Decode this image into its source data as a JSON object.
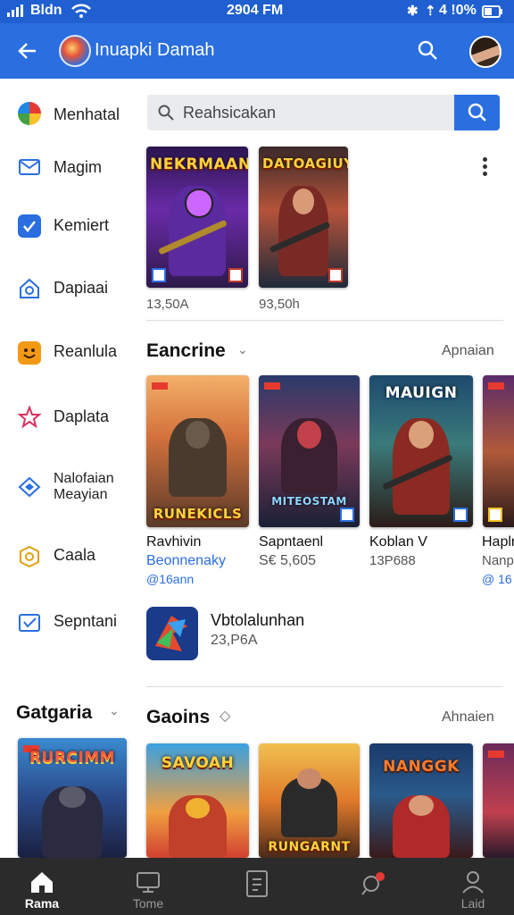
{
  "status_bar": {
    "carrier": "Bldn",
    "time": "2904 FM",
    "battery": "4 !0%"
  },
  "app_bar": {
    "title": "Inuapki Damah",
    "icons": [
      "back-arrow-icon",
      "app-logo",
      "search-icon",
      "avatar"
    ]
  },
  "sidebar": {
    "items": [
      {
        "label": "Menhatal",
        "icon": "color-wheel-icon"
      },
      {
        "label": "Magim",
        "icon": "mail-icon"
      },
      {
        "label": "Kemiert",
        "icon": "check-square-icon"
      },
      {
        "label": "Dapiaai",
        "icon": "home-shield-icon"
      },
      {
        "label": "Reanlula",
        "icon": "smiley-icon"
      },
      {
        "label": "Daplata",
        "icon": "star-icon"
      },
      {
        "label": "Nalofaian",
        "label2": "Meayian",
        "icon": "badge-icon"
      },
      {
        "label": "Caala",
        "icon": "coin-icon"
      },
      {
        "label": "Sepntani",
        "icon": "mail-check-icon"
      }
    ]
  },
  "search": {
    "placeholder": "Reahsicakan"
  },
  "top_row": [
    {
      "poster_title": "NEKRMAAN",
      "count": "13,50A"
    },
    {
      "poster_title": "DATOAGIUY",
      "count": "93,50h"
    }
  ],
  "featured": {
    "title": "Eancrine",
    "link": "Apnaian",
    "cards": [
      {
        "poster_title": "",
        "poster_bottom": "RUNEKICLS",
        "name": "Ravhivin",
        "sub": "Beonnenaky",
        "meta": "@16ann"
      },
      {
        "poster_title": "",
        "poster_bottom": "MITEOSTAM",
        "name": "Sapntaenl",
        "sub": "S€ 5,605",
        "meta": ""
      },
      {
        "poster_title": "MAUIGN",
        "poster_bottom": "",
        "name": "Koblan V",
        "sub": "13P688",
        "meta": ""
      },
      {
        "poster_title": "",
        "poster_bottom": "",
        "name": "Haplr",
        "sub": "Nanp",
        "meta": "@ 16"
      }
    ]
  },
  "app_item": {
    "name": "Vbtolalunhan",
    "count": "23,P6A"
  },
  "categories": {
    "title": "Gatgaria"
  },
  "games": {
    "title": "Gaoins",
    "link": "Ahnaien",
    "cards": [
      {
        "poster_title": "RURCIMM"
      },
      {
        "poster_title": "SAVOAH"
      },
      {
        "poster_title": "",
        "poster_bottom": "RUNGARNT"
      },
      {
        "poster_title": "NANGGK"
      },
      {
        "poster_title": ""
      }
    ]
  },
  "bottom_nav": {
    "items": [
      {
        "label": "Rama",
        "icon": "home-icon",
        "active": true
      },
      {
        "label": "Tome",
        "icon": "monitor-icon"
      },
      {
        "label": "",
        "icon": "document-icon"
      },
      {
        "label": "",
        "icon": "notification-icon"
      },
      {
        "label": "Laid",
        "icon": "profile-icon"
      }
    ]
  },
  "colors": {
    "primary": "#2a6ee0",
    "status_bar": "#1f5fd0",
    "nav_bg": "#2b2b2b"
  }
}
